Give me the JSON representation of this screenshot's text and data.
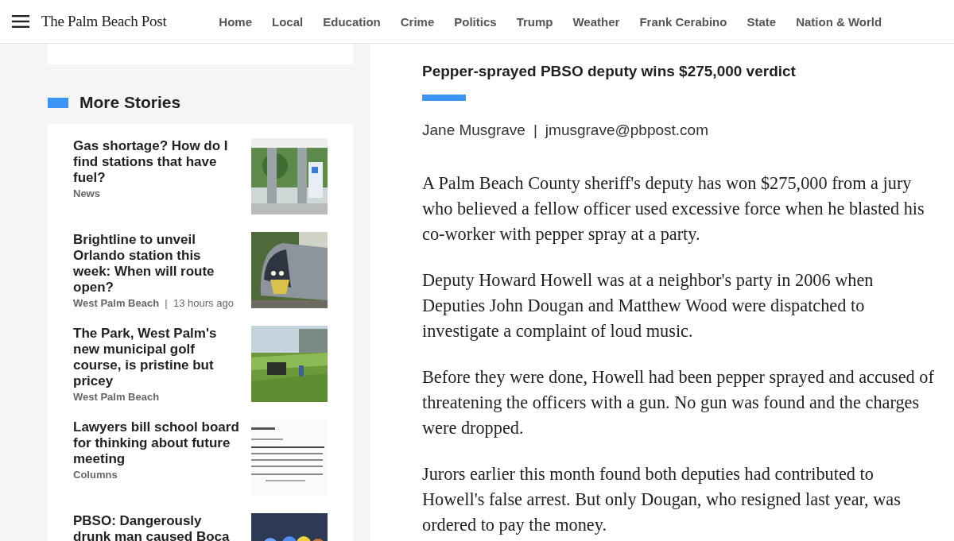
{
  "header": {
    "logo": "The Palm Beach Post",
    "nav": [
      "Home",
      "Local",
      "Education",
      "Crime",
      "Politics",
      "Trump",
      "Weather",
      "Frank Cerabino",
      "State",
      "Nation & World"
    ]
  },
  "sidebar": {
    "title": "More Stories",
    "stories": [
      {
        "headline": "Gas shortage? How do I find stations that have fuel?",
        "meta": "**News**"
      },
      {
        "headline": "Brightline to unveil Orlando station this week: When will route open?",
        "meta": "**West Palm Beach**  |  13 hours ago"
      },
      {
        "headline": "The Park, West Palm's new municipal golf course, is pristine but pricey",
        "meta": "**West Palm Beach**"
      },
      {
        "headline": "Lawyers bill school board for thinking about future meeting",
        "meta": "**Columns**"
      },
      {
        "headline": "PBSO: Dangerously drunk man caused Boca"
      }
    ]
  },
  "article": {
    "headline": "Pepper-sprayed PBSO deputy wins $275,000 verdict",
    "author": "Jane Musgrave",
    "separator": "|",
    "email": "jmusgrave@pbpost.com",
    "paragraphs": [
      "A Palm Beach County sheriff's deputy has won $275,000 from a jury who believed a fellow officer used excessive force when he blasted his co-worker with pepper spray at a party.",
      "Deputy Howard Howell was at a neighbor's party in 2006 when Deputies John Dougan and Matthew Wood were dispatched to investigate a complaint of loud music.",
      "Before they were done, Howell had been pepper sprayed and accused of threatening the officers with a gun. No gun was found and the charges were dropped.",
      "Jurors earlier this month found both deputies had contributed to Howell's false arrest. But only Dougan, who resigned last year, was ordered to pay the money."
    ]
  }
}
